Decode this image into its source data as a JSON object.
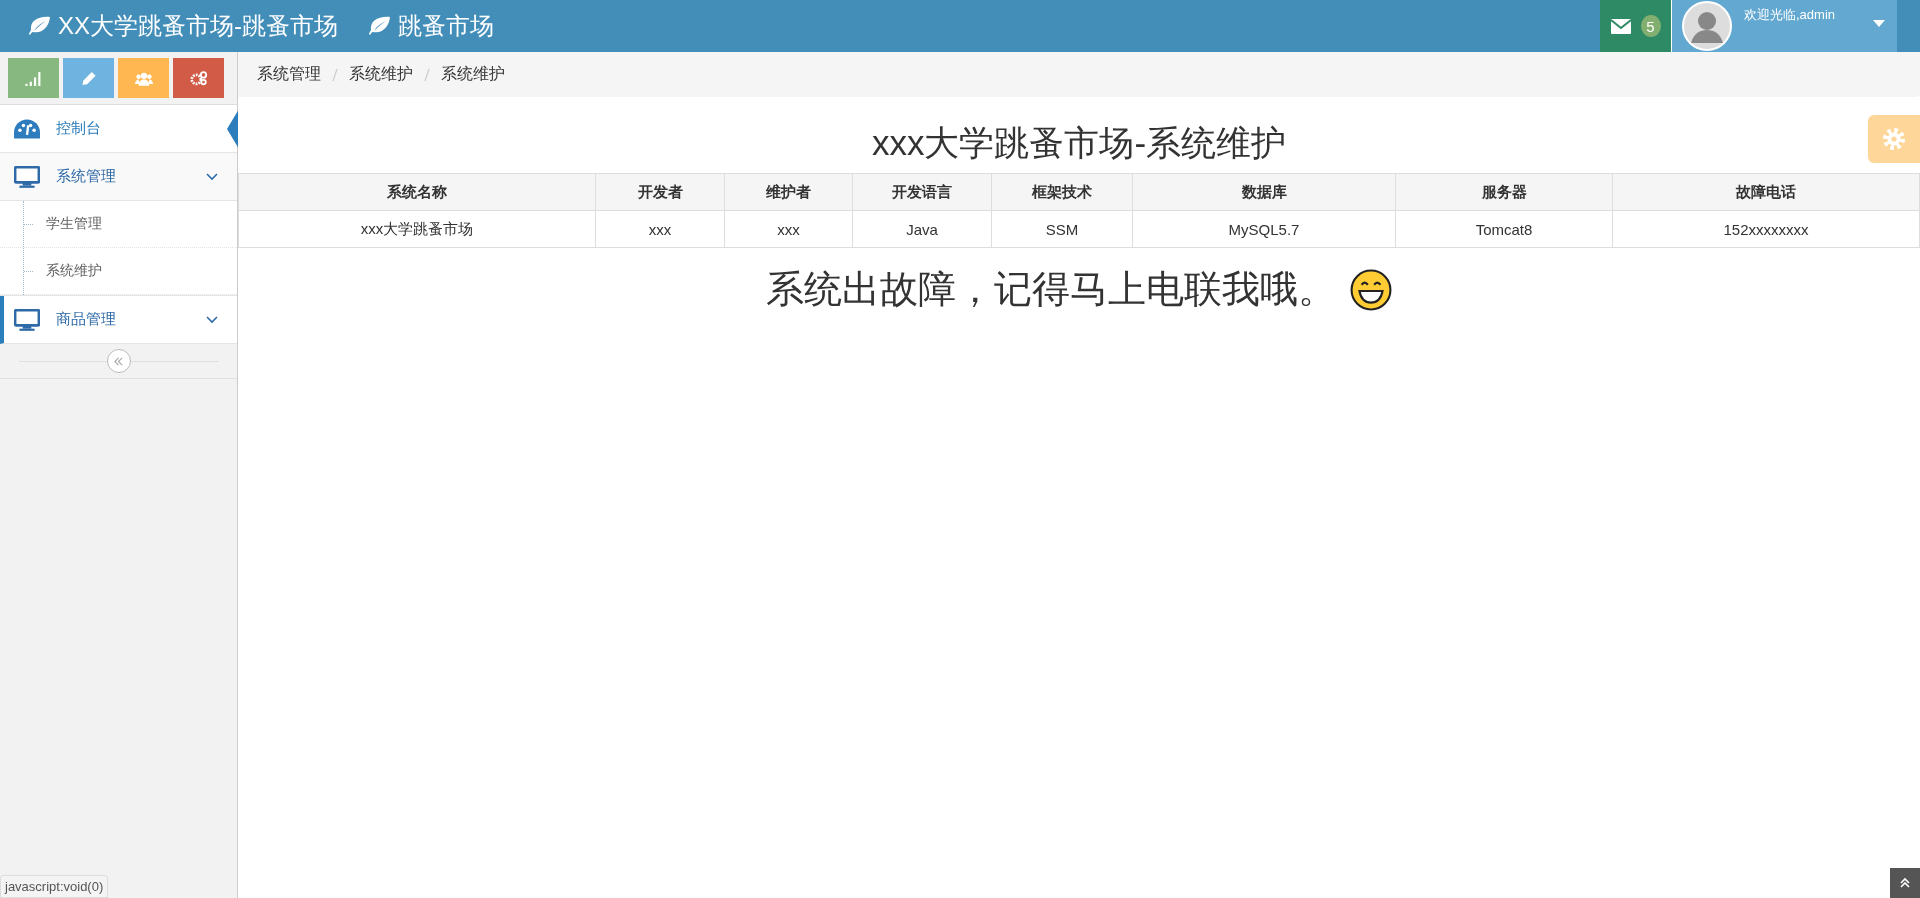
{
  "navbar": {
    "brand": "XX大学跳蚤市场-跳蚤市场",
    "subtitle": "跳蚤市场",
    "messages": {
      "count": "5"
    },
    "user": {
      "greeting": "欢迎光临,admin"
    }
  },
  "shortcuts": [
    {
      "kind": "chart",
      "color": "#87b87f"
    },
    {
      "kind": "pencil",
      "color": "#6fb3e0"
    },
    {
      "kind": "users",
      "color": "#ffb752"
    },
    {
      "kind": "cogs",
      "color": "#d15b47"
    }
  ],
  "breadcrumb": [
    "系统管理",
    "系统维护",
    "系统维护"
  ],
  "sidebar": {
    "items": [
      {
        "label": "控制台",
        "kind": "dashboard",
        "selected": true,
        "expanded": false,
        "open_marker": false
      },
      {
        "label": "系统管理",
        "kind": "desktop",
        "selected": false,
        "expanded": true,
        "open_marker": false,
        "children": [
          {
            "label": "学生管理"
          },
          {
            "label": "系统维护"
          }
        ]
      },
      {
        "label": "商品管理",
        "kind": "desktop",
        "selected": false,
        "expanded": false,
        "open_marker": true
      }
    ]
  },
  "page_title": "xxx大学跳蚤市场-系统维护",
  "table": {
    "columns": [
      "系统名称",
      "开发者",
      "维护者",
      "开发语言",
      "框架技术",
      "数据库",
      "服务器",
      "故障电话"
    ],
    "rows": [
      [
        "xxx大学跳蚤市场",
        "xxx",
        "xxx",
        "Java",
        "SSM",
        "MySQL5.7",
        "Tomcat8",
        "152xxxxxxxx"
      ]
    ]
  },
  "message": "系统出故障，记得马上电联我哦。",
  "status_bar": {
    "link": "javascript:void(0)"
  }
}
